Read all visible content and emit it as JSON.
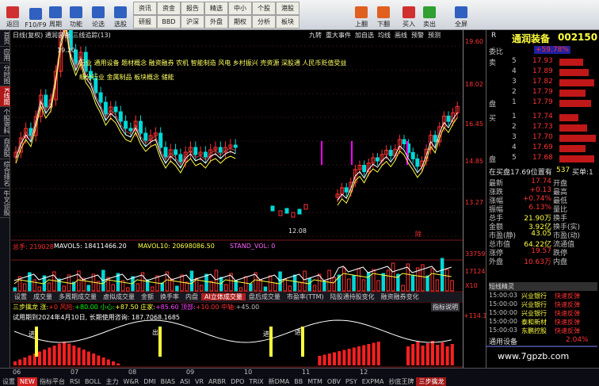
{
  "toolbar": {
    "buttons": [
      {
        "label": "返回",
        "icon": "back-icon"
      },
      {
        "label": "F10/F9",
        "icon": "f10-icon"
      },
      {
        "label": "周期",
        "icon": "period-icon"
      },
      {
        "label": "功能",
        "icon": "function-icon"
      },
      {
        "label": "论选",
        "icon": "select-icon"
      },
      {
        "label": "选股",
        "icon": "stock-select-icon"
      },
      {
        "label": "画线",
        "icon": "draw-line-icon"
      },
      {
        "label": "自选",
        "icon": "favorite-icon"
      },
      {
        "label": "龙虎",
        "icon": "dragon-tiger-icon"
      },
      {
        "label": "数据",
        "icon": "data-icon"
      },
      {
        "label": "热点",
        "icon": "hotspot-icon"
      },
      {
        "label": "关联",
        "icon": "link-icon"
      },
      {
        "label": "上翻",
        "icon": "page-up-icon"
      },
      {
        "label": "下翻",
        "icon": "page-down-icon"
      },
      {
        "label": "买入",
        "icon": "buy-icon"
      },
      {
        "label": "卖出",
        "icon": "sell-icon"
      },
      {
        "label": "全屏",
        "icon": "fullscreen-icon"
      }
    ],
    "small_buttons": [
      "资讯",
      "研报",
      "资金",
      "BBD",
      "报告",
      "沪深",
      "精选",
      "外盘",
      "中小",
      "期权",
      "个股",
      "分析",
      "港股",
      "板块"
    ]
  },
  "leftbar": [
    "首页",
    "应用",
    "分时图",
    "K线图",
    "个股资料",
    "自选股",
    "综合排名",
    "牛叉诊股"
  ],
  "chart": {
    "header": "日线(复权) 通润装备 三线追踪(13)",
    "header_right": [
      "九转",
      "重大事件",
      "加自选",
      "均线",
      "画线",
      "预警",
      "预测"
    ],
    "subject_lines": [
      "行业  通用设备    题材概念  融资融券  农机  智能制造  风电  乡村振兴  壳资源  深股通  人民币贬值受益",
      "细分行业  金属制品  板块概念  储能"
    ],
    "high_label": "19.20",
    "low_label": "12.08",
    "xdr_label": "除",
    "price_axis": [
      "19.60",
      "18.02",
      "16.45",
      "14.85",
      "13.27"
    ],
    "volume_header": {
      "name": "总手: 219028",
      "mavol5": "MAVOL5: 18411466.20",
      "mavol10": "MAVOL10: 20698086.50",
      "stand": "STAND_VOL: 0"
    },
    "volume_axis": [
      "33759",
      "17124",
      "X10"
    ],
    "indicator_tabs": [
      "设置",
      "成交量",
      "多周期成交量",
      "虚拟成交量",
      "金额",
      "换手率",
      "内盘",
      "AI立体成交量",
      "盘后成交量",
      "市盈率(TTM)",
      "陆股通持股变化",
      "融资融券变化"
    ],
    "indicator_header": {
      "name": "三步擒龙 涨:",
      "v1": "+0 风险:",
      "v2": "+80.00 小心:",
      "v3": "+87.50 庄家:",
      "v4": "+85.60 顶部:",
      "v5": "+10.00 中轴:",
      "v6": "+45.00"
    },
    "indicator_note": "试用期到2024年4月10日, 长期使用咨询: 187.7068.1685",
    "indicator_right": "指标说明",
    "indicator_axis": "+114.1",
    "signal_labels": [
      "进",
      "出",
      "进",
      "进"
    ],
    "months": [
      "06",
      "07",
      "08",
      "09",
      "10",
      "11",
      "12"
    ]
  },
  "quote": {
    "code_label": "R",
    "name": "通润装备",
    "code": "002150",
    "weibi_label": "委比",
    "weibi": "+59.78%",
    "sell": [
      [
        "卖",
        "5",
        "17.93"
      ],
      [
        "",
        "4",
        "17.89"
      ],
      [
        "",
        "3",
        "17.82"
      ],
      [
        "",
        "2",
        "17.79"
      ],
      [
        "盘",
        "1",
        "17.79"
      ]
    ],
    "buy": [
      [
        "买",
        "1",
        "17.74"
      ],
      [
        "",
        "2",
        "17.73"
      ],
      [
        "",
        "3",
        "17.70"
      ],
      [
        "",
        "4",
        "17.69"
      ],
      [
        "盘",
        "5",
        "17.68"
      ]
    ],
    "position_label": "在买盘17.69位置有",
    "position_value": "537",
    "position_action": "买单:1",
    "stats": [
      [
        "最新",
        "17.74",
        "开盘",
        ""
      ],
      [
        "涨跌",
        "+0.13",
        "最高",
        ""
      ],
      [
        "涨幅",
        "+0.74%",
        "最低",
        ""
      ],
      [
        "振幅",
        "6.13%",
        "量比",
        ""
      ],
      [
        "总手",
        "21.90万",
        "换手",
        ""
      ],
      [
        "金额",
        "3.92亿",
        "换手(实)",
        ""
      ],
      [
        "市盈(静)",
        "43.05",
        "市盈(动)",
        ""
      ],
      [
        "总市值",
        "64.22亿",
        "流通值",
        ""
      ],
      [
        "涨停",
        "19.57",
        "跌停",
        ""
      ],
      [
        "外盘",
        "10.63万",
        "内盘",
        ""
      ]
    ],
    "news_header": "短线精灵",
    "news": [
      [
        "15:00:03",
        "兴业银行",
        "快速反弹"
      ],
      [
        "15:00:00",
        "兴业银行",
        "快速反弹"
      ],
      [
        "15:00:00",
        "兴业银行",
        "快速反弹"
      ],
      [
        "15:00:00",
        "泰和新材",
        "快速反弹"
      ],
      [
        "15:00:03",
        "东鹏控股",
        "快速反弹"
      ]
    ],
    "footer_name": "通用设备",
    "footer_value": "2.04%"
  },
  "bottom_tabs": [
    "设置",
    "NEW",
    "指标平台",
    "RSI",
    "BOLL",
    "主力",
    "W&R",
    "DMI",
    "BIAS",
    "ASI",
    "VR",
    "ARBR",
    "DPO",
    "TRIX",
    "新DMA",
    "BB",
    "MTM",
    "OBV",
    "PSY",
    "EXPMA",
    "抄底王牌",
    "三步擒龙"
  ],
  "watermark": "www.7gpzb.com",
  "colors": {
    "up": "#ff3232",
    "down": "#00d8d8",
    "ma": "#ffffff",
    "bg": "#000000",
    "yellow": "#ffff00",
    "magenta": "#ff00ff"
  }
}
